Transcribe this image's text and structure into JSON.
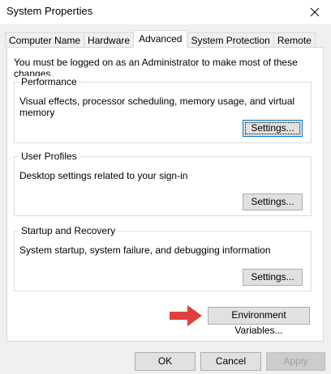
{
  "window": {
    "title": "System Properties"
  },
  "tabs": [
    {
      "label": "Computer Name",
      "active": false
    },
    {
      "label": "Hardware",
      "active": false
    },
    {
      "label": "Advanced",
      "active": true
    },
    {
      "label": "System Protection",
      "active": false
    },
    {
      "label": "Remote",
      "active": false
    }
  ],
  "notice": "You must be logged on as an Administrator to make most of these changes.",
  "performance": {
    "title": "Performance",
    "description": "Visual effects, processor scheduling, memory usage, and virtual memory",
    "button": "Settings..."
  },
  "user_profiles": {
    "title": "User Profiles",
    "description": "Desktop settings related to your sign-in",
    "button": "Settings..."
  },
  "startup_recovery": {
    "title": "Startup and Recovery",
    "description": "System startup, system failure, and debugging information",
    "button": "Settings..."
  },
  "env_button": "Environment Variables...",
  "footer": {
    "ok": "OK",
    "cancel": "Cancel",
    "apply": "Apply"
  },
  "colors": {
    "accent": "#0078d7",
    "arrow": "#e0403a"
  }
}
